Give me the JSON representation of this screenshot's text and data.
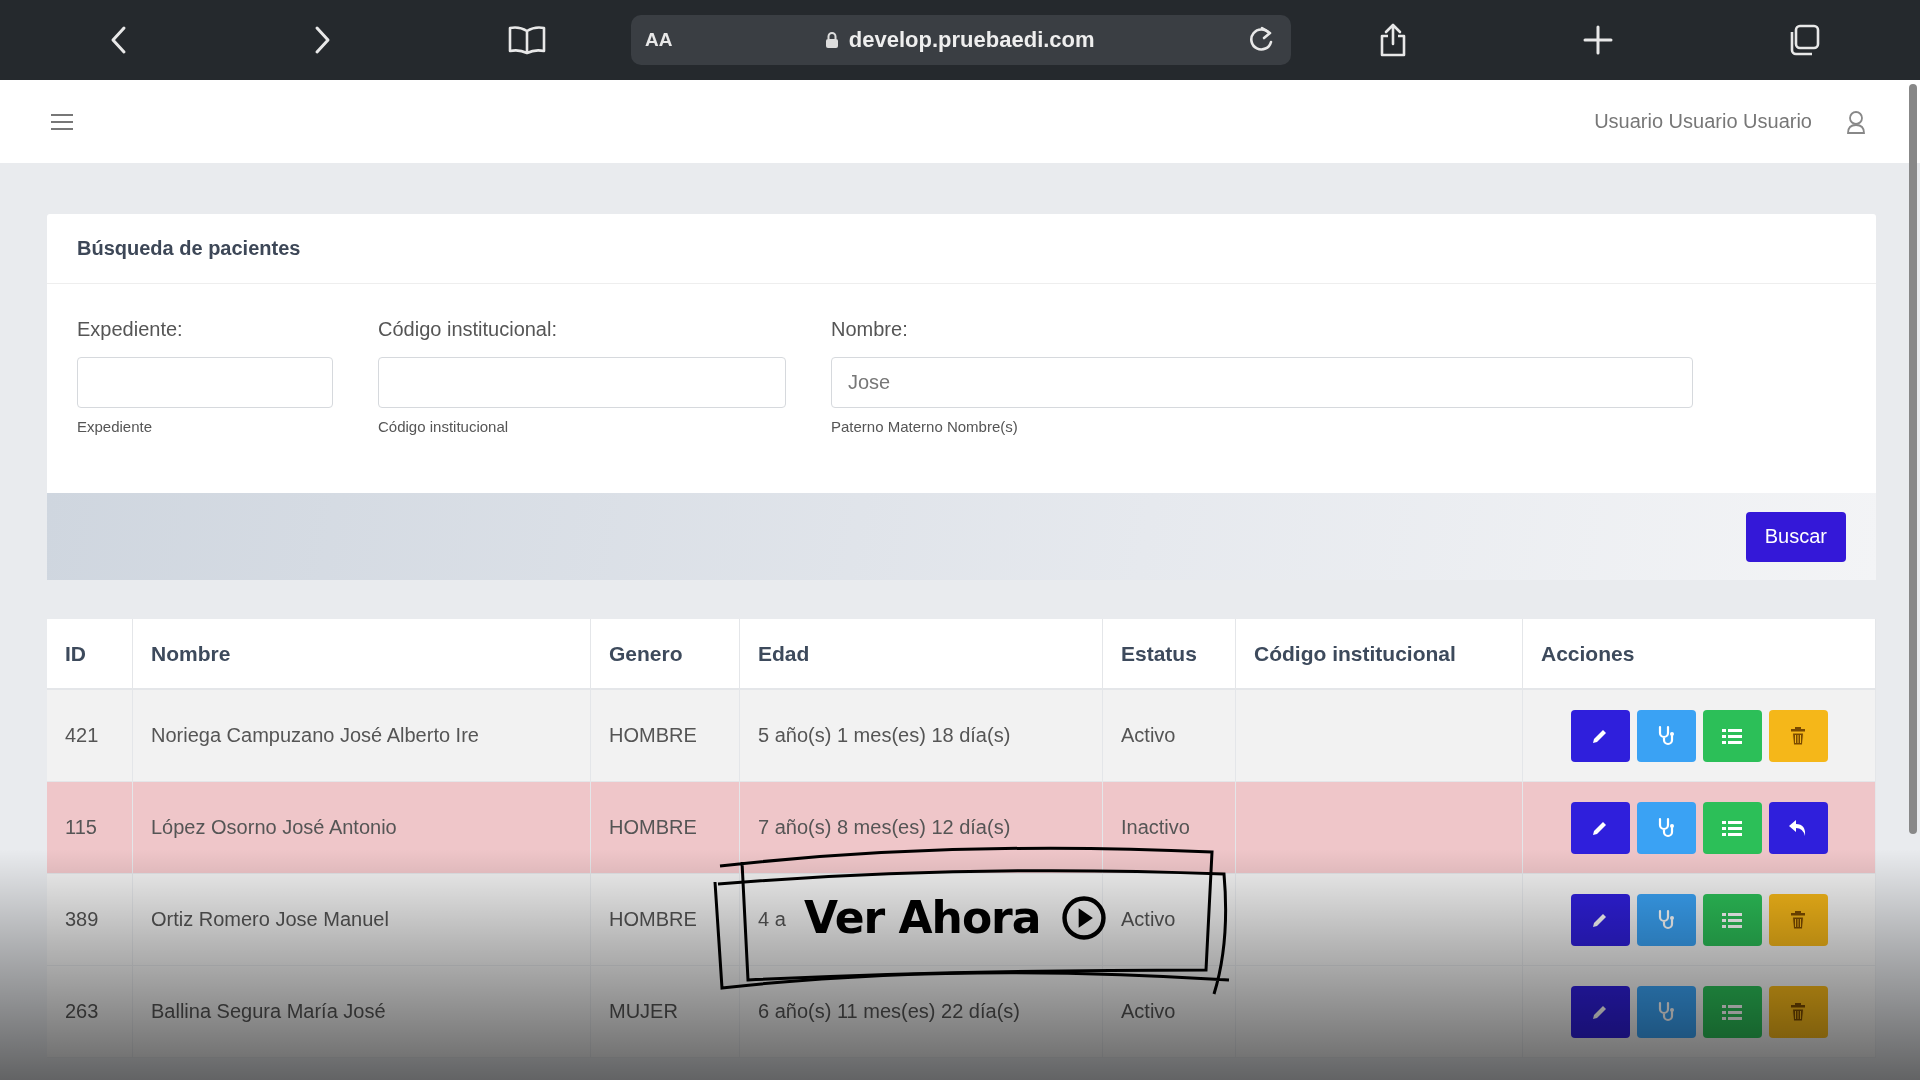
{
  "browser": {
    "text_size": "AA",
    "url": "develop.pruebaedi.com"
  },
  "header": {
    "user": "Usuario Usuario Usuario"
  },
  "search": {
    "title": "Búsqueda de pacientes",
    "fields": [
      {
        "label": "Expediente:",
        "help": "Expediente"
      },
      {
        "label": "Código institucional:",
        "help": "Código institucional"
      },
      {
        "label": "Nombre:",
        "value": "Jose",
        "help": "Paterno Materno Nombre(s)"
      }
    ],
    "button": "Buscar"
  },
  "table": {
    "columns": [
      "ID",
      "Nombre",
      "Genero",
      "Edad",
      "Estatus",
      "Código institucional",
      "Acciones"
    ],
    "rows": [
      {
        "id": "421",
        "name": "Noriega Campuzano José Alberto Ire",
        "gender": "HOMBRE",
        "age": "5 año(s) 1 mes(es) 18 día(s)",
        "status": "Activo",
        "inactive": false,
        "actions": [
          {
            "kind": "edit"
          },
          {
            "kind": "consult"
          },
          {
            "kind": "list"
          },
          {
            "kind": "delete"
          }
        ]
      },
      {
        "id": "115",
        "name": "López Osorno José Antonio",
        "gender": "HOMBRE",
        "age": "7 año(s) 8 mes(es) 12 día(s)",
        "status": "Inactivo",
        "inactive": true,
        "actions": [
          {
            "kind": "edit"
          },
          {
            "kind": "consult"
          },
          {
            "kind": "list"
          },
          {
            "kind": "restore"
          }
        ]
      },
      {
        "id": "389",
        "name": "Ortiz Romero Jose Manuel",
        "gender": "HOMBRE",
        "age": "4 a",
        "status": "Activo",
        "inactive": false,
        "actions": [
          {
            "kind": "edit"
          },
          {
            "kind": "consult"
          },
          {
            "kind": "list"
          },
          {
            "kind": "delete"
          }
        ]
      },
      {
        "id": "263",
        "name": "Ballina Segura María José",
        "gender": "MUJER",
        "age": "6 año(s) 11 mes(es) 22 día(s)",
        "status": "Activo",
        "inactive": false,
        "actions": [
          {
            "kind": "edit"
          },
          {
            "kind": "consult"
          },
          {
            "kind": "list"
          },
          {
            "kind": "delete"
          }
        ]
      }
    ]
  },
  "overlay": {
    "label": "Ver Ahora"
  }
}
